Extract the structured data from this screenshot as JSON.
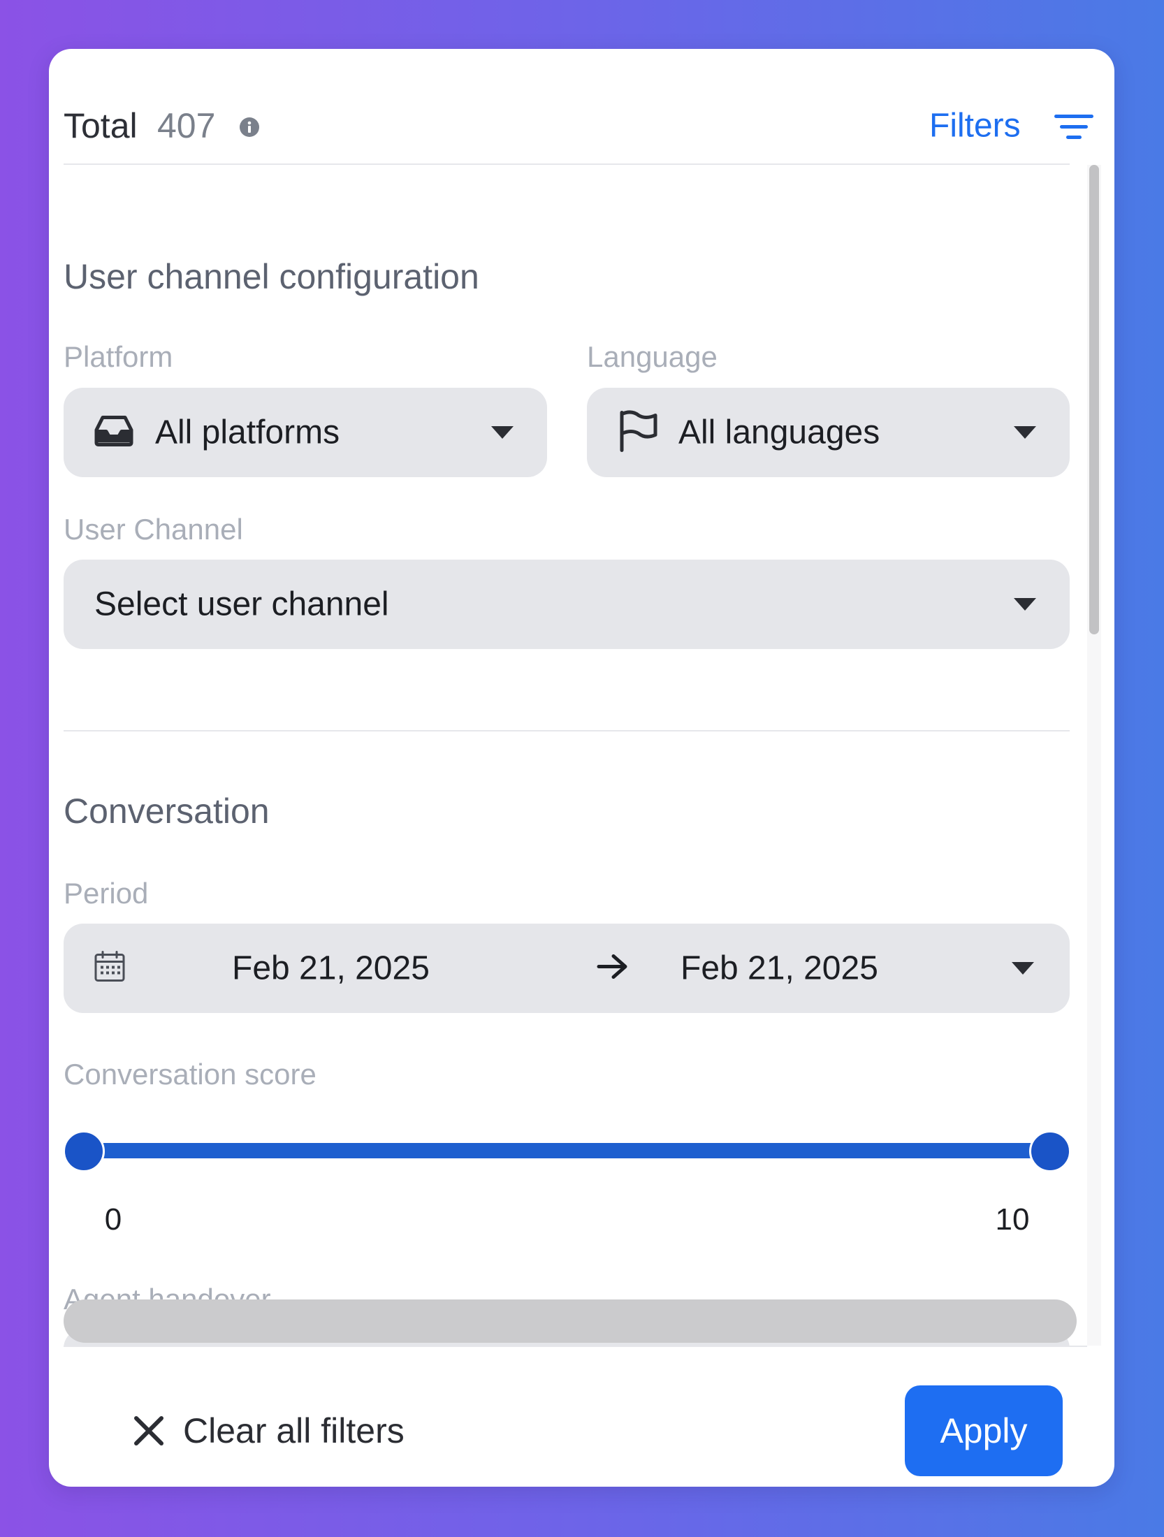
{
  "header": {
    "total_label": "Total",
    "total_count": "407",
    "filters_label": "Filters",
    "info_icon": "info-icon",
    "filters_icon": "filter-lines-icon"
  },
  "sections": {
    "user_channel": {
      "title": "User channel configuration",
      "platform": {
        "label": "Platform",
        "value": "All platforms",
        "icon": "inbox-icon"
      },
      "language": {
        "label": "Language",
        "value": "All languages",
        "icon": "flag-icon"
      },
      "user_channel": {
        "label": "User Channel",
        "placeholder": "Select user channel"
      }
    },
    "conversation": {
      "title": "Conversation",
      "period": {
        "label": "Period",
        "start": "Feb 21, 2025",
        "end": "Feb 21, 2025",
        "icon": "calendar-icon",
        "separator_icon": "arrow-right-icon"
      },
      "score": {
        "label": "Conversation score",
        "min": "0",
        "max": "10"
      },
      "agent_handover": {
        "label": "Agent handover"
      }
    }
  },
  "footer": {
    "clear_label": "Clear all filters",
    "apply_label": "Apply"
  },
  "colors": {
    "accent": "#1e6ef2",
    "slider": "#1e5fcf",
    "field_bg": "#e5e6ea"
  }
}
